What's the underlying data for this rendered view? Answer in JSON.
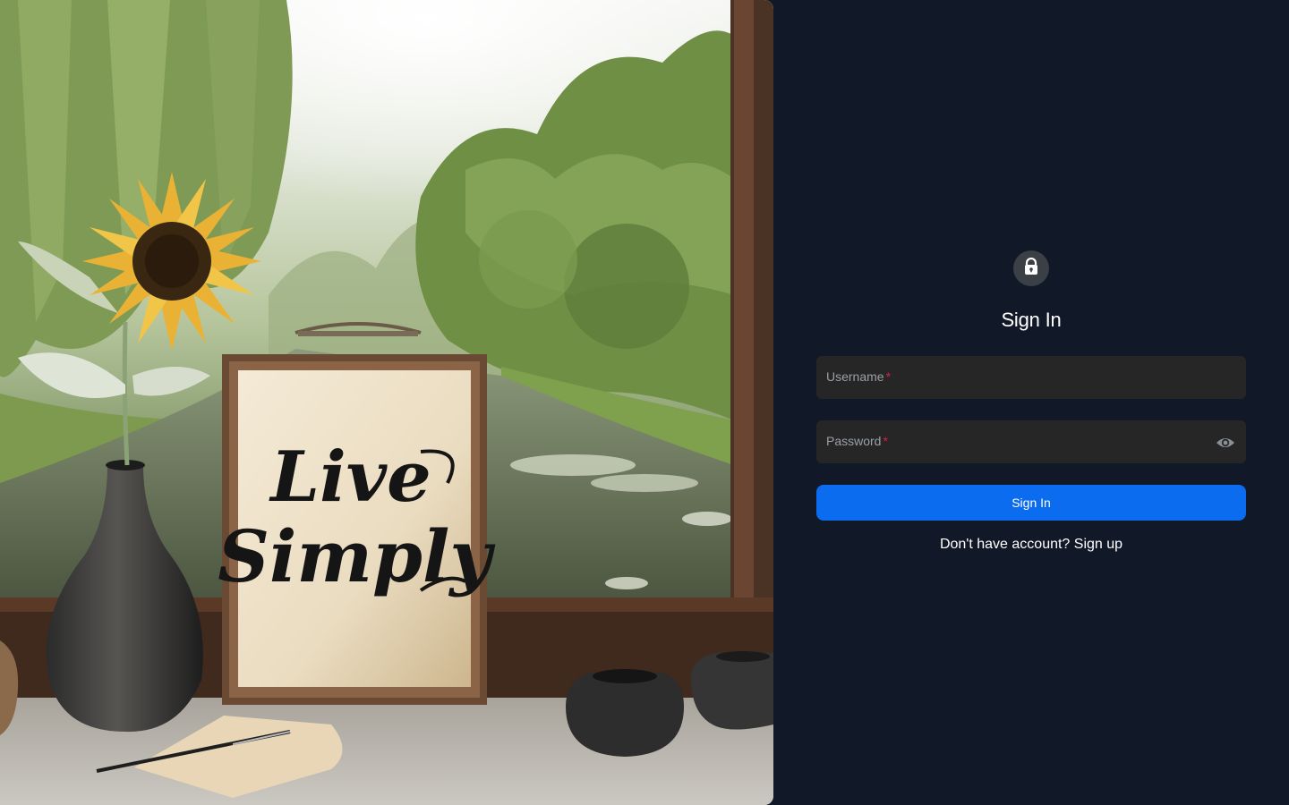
{
  "hero": {
    "sign_text_line1": "Live",
    "sign_text_line2": "Simply"
  },
  "auth": {
    "lock_icon": "lock-icon",
    "title": "Sign In",
    "username": {
      "label": "Username",
      "required_mark": "*",
      "value": ""
    },
    "password": {
      "label": "Password",
      "required_mark": "*",
      "value": "",
      "toggle_icon": "eye-icon"
    },
    "submit_label": "Sign In",
    "no_account_text": "Don't have account?",
    "signup_link": "Sign up"
  },
  "colors": {
    "panel_bg": "#111827",
    "input_bg": "#262626",
    "primary": "#0b6cf0",
    "required": "#e11d48"
  }
}
